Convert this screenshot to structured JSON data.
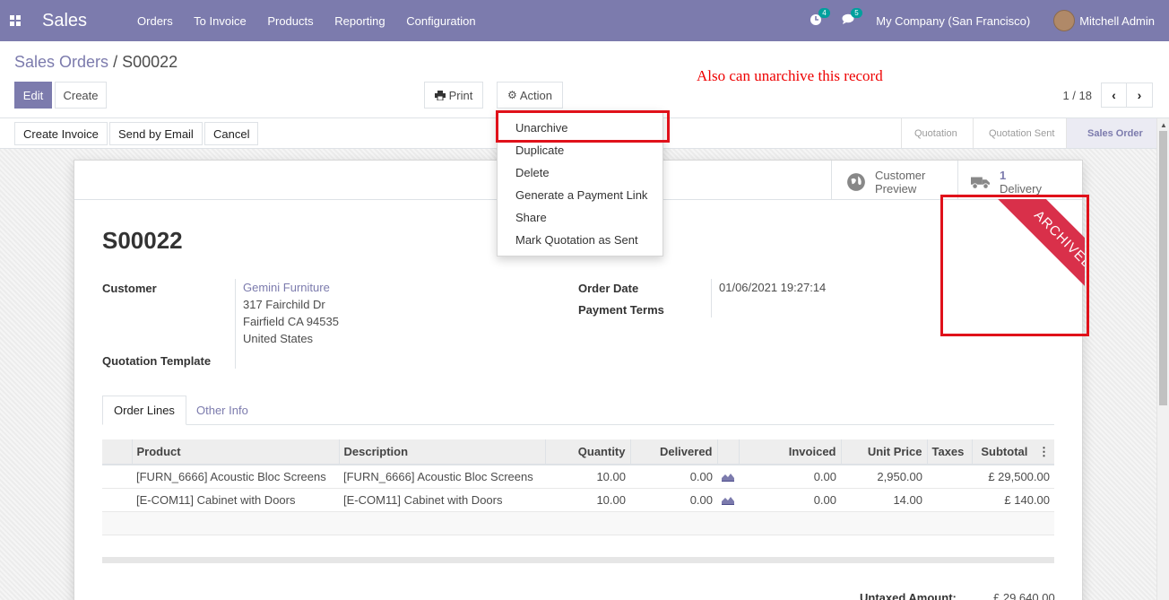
{
  "navbar": {
    "app_name": "Sales",
    "menu": [
      "Orders",
      "To Invoice",
      "Products",
      "Reporting",
      "Configuration"
    ],
    "activity_count": "4",
    "messages_count": "5",
    "company": "My Company (San Francisco)",
    "user": "Mitchell Admin"
  },
  "control_panel": {
    "breadcrumb_parent": "Sales Orders",
    "breadcrumb_separator": "/",
    "breadcrumb_current": "S00022",
    "edit_label": "Edit",
    "create_label": "Create",
    "print_label": "Print",
    "action_label": "Action",
    "annotation": "Also can unarchive this record",
    "pager_value": "1 / 18"
  },
  "statusbar": {
    "buttons": [
      "Create Invoice",
      "Send by Email",
      "Cancel"
    ],
    "stages": [
      "Quotation",
      "Quotation Sent",
      "Sales Order"
    ],
    "active_stage": "Sales Order"
  },
  "action_menu": {
    "items": [
      "Unarchive",
      "Duplicate",
      "Delete",
      "Generate a Payment Link",
      "Share",
      "Mark Quotation as Sent"
    ]
  },
  "smart_buttons": {
    "customer_preview": [
      "Customer",
      "Preview"
    ],
    "delivery_count": "1",
    "delivery_label": "Delivery"
  },
  "record": {
    "name": "S00022",
    "ribbon": "ARCHIVED",
    "customer_label": "Customer",
    "customer_name": "Gemini Furniture",
    "customer_address": [
      "317 Fairchild Dr",
      "Fairfield CA 94535",
      "United States"
    ],
    "quotation_template_label": "Quotation Template",
    "order_date_label": "Order Date",
    "order_date": "01/06/2021 19:27:14",
    "payment_terms_label": "Payment Terms"
  },
  "tabs": [
    "Order Lines",
    "Other Info"
  ],
  "order_lines": {
    "columns": [
      "Product",
      "Description",
      "Quantity",
      "Delivered",
      "",
      "Invoiced",
      "Unit Price",
      "Taxes",
      "Subtotal"
    ],
    "rows": [
      {
        "product": "[FURN_6666] Acoustic Bloc Screens",
        "description": "[FURN_6666] Acoustic Bloc Screens",
        "quantity": "10.00",
        "delivered": "0.00",
        "invoiced": "0.00",
        "unit_price": "2,950.00",
        "taxes": "",
        "subtotal": "£ 29,500.00"
      },
      {
        "product": "[E-COM11] Cabinet with Doors",
        "description": "[E-COM11] Cabinet with Doors",
        "quantity": "10.00",
        "delivered": "0.00",
        "invoiced": "0.00",
        "unit_price": "14.00",
        "taxes": "",
        "subtotal": "£ 140.00"
      }
    ]
  },
  "totals": {
    "untaxed_label": "Untaxed Amount:",
    "untaxed_value": "£ 29,640.00"
  },
  "colors": {
    "brand": "#7c7bad",
    "ribbon": "#d9304a",
    "highlight": "#e0111a",
    "annotation": "#ee0000"
  }
}
